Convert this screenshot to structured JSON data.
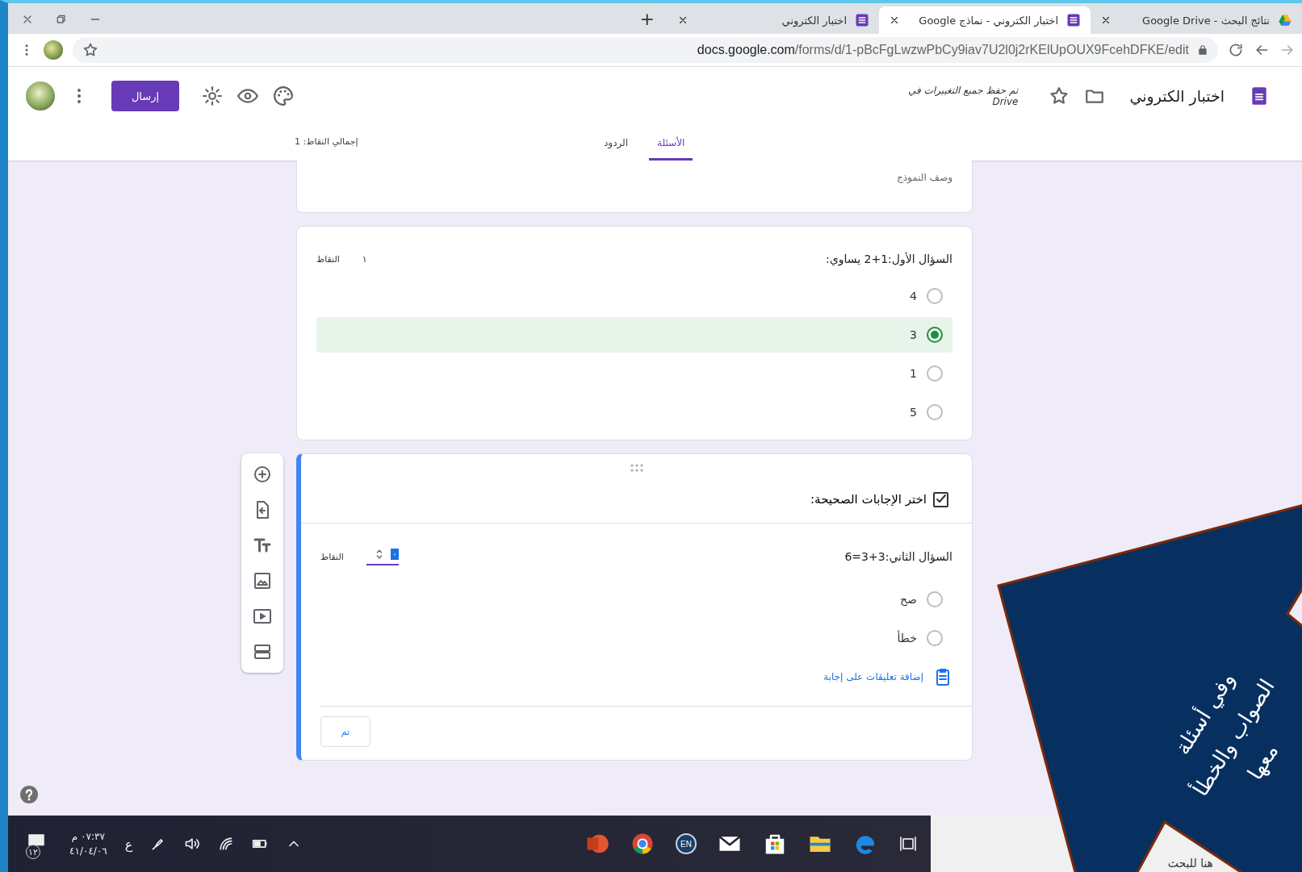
{
  "browser": {
    "tabs": [
      {
        "title": "نتائج البحث - Google Drive",
        "selected": false,
        "kind": "drive"
      },
      {
        "title": "اختبار الكتروني - نماذج Google",
        "selected": true,
        "kind": "forms"
      },
      {
        "title": "اختبار الكتروني",
        "selected": false,
        "kind": "forms"
      }
    ],
    "new_tab": "+",
    "url_host": "docs.google.com",
    "url_path": "/forms/d/1-pBcFgLwzwPbCy9iav7U2l0j2rKElUpOUX9FcehDFKE/edit"
  },
  "form_header": {
    "title": "اختبار الكتروني",
    "save_status": "تم حفظ جميع التغييرات في",
    "save_location": "Drive",
    "send_button": "إرسال",
    "tabs": [
      {
        "label": "الأسئلة",
        "selected": true
      },
      {
        "label": "الردود",
        "selected": false
      }
    ],
    "total_points": "إجمالي النقاط: 1"
  },
  "description_placeholder": "وصف النموذج",
  "questions": [
    {
      "kind": "graded",
      "active": false,
      "title": "السؤال الأول:1+2 يساوي:",
      "points": "١",
      "points_label": "النقاط",
      "options": [
        {
          "label": "4",
          "selected": false
        },
        {
          "label": "3",
          "selected": true
        },
        {
          "label": "1",
          "selected": false
        },
        {
          "label": "5",
          "selected": false
        }
      ]
    },
    {
      "kind": "answer_key",
      "active": true,
      "section_title": "اختر الإجابات الصحيحة:",
      "title": "السؤال الثاني:3+3=6",
      "points": "٠",
      "points_label": "النقاط",
      "options": [
        {
          "label": "صح",
          "selected": false
        },
        {
          "label": "خطأ",
          "selected": false
        }
      ],
      "feedback_link": "إضافة تعليقات على إجابة",
      "done_button": "تم"
    }
  ],
  "overlay": {
    "lines": [
      "وفي أسئلة",
      "الصواب والخطأ",
      "معها"
    ]
  },
  "taskbar": {
    "search_placeholder": "هنا للبحث",
    "time": "٠٧:٣٧ م",
    "date": "٤١/٠٤/٠٦",
    "language": "ع",
    "notification_count": "١٢",
    "keyboard_badge": "EN"
  }
}
